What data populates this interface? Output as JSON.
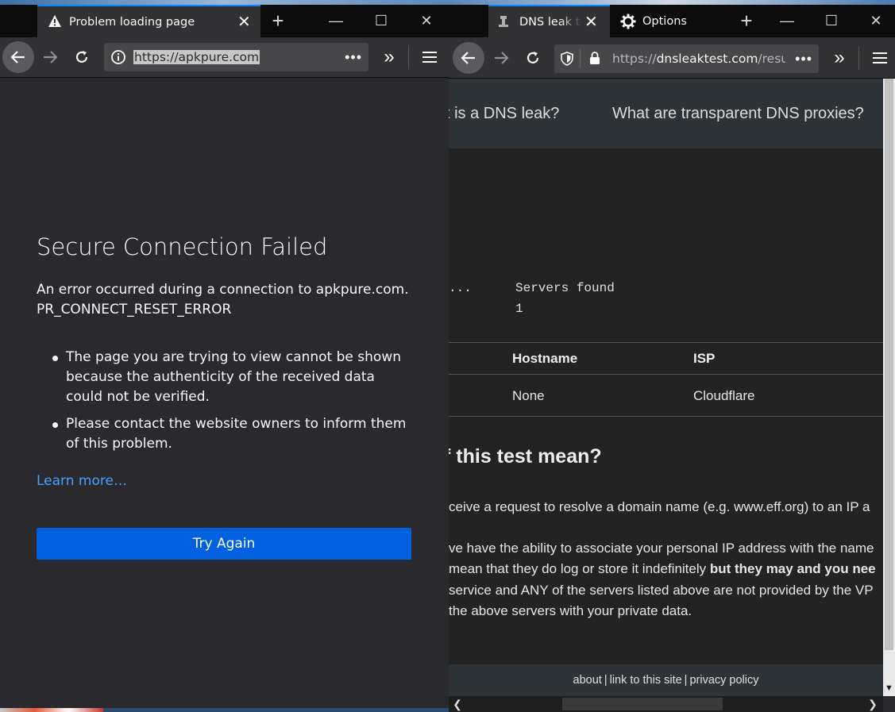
{
  "left_window": {
    "tab": {
      "title": "Problem loading page"
    },
    "url": "https://apkpure.com",
    "error": {
      "title": "Secure Connection Failed",
      "description": "An error occurred during a connection to apkpure.com.",
      "code": "PR_CONNECT_RESET_ERROR",
      "bullets": [
        "The page you are trying to view cannot be shown because the authenticity of the received data could not be verified.",
        "Please contact the website owners to inform them of this problem."
      ],
      "learn_more": "Learn more…",
      "try_again": "Try Again"
    }
  },
  "right_window": {
    "tabs": [
      {
        "title": "DNS leak test"
      },
      {
        "title": "Options"
      }
    ],
    "url_prefix": "https://",
    "url_host": "dnsleaktest.com",
    "url_path": "/results",
    "nav": {
      "item1": "t is a DNS leak?",
      "item2": "What are transparent DNS proxies?"
    },
    "summary": {
      "ellipsis": "...",
      "servers_label": "Servers found",
      "servers_count": "1"
    },
    "table": {
      "headers": [
        "Hostname",
        "ISP"
      ],
      "rows": [
        [
          "None",
          "Cloudflare"
        ]
      ]
    },
    "section_title": "f this test mean?",
    "paragraph_lines": [
      "ceive a request to resolve a domain name (e.g. www.eff.org) to an IP a",
      "ve have the ability to associate your personal IP address with the name",
      "mean that they do log or store it indefinitely ",
      "but they may and you nee",
      "service and ANY of the servers listed above are not provided by the VP",
      " the above servers with your private data."
    ],
    "footer": {
      "about": "about",
      "link": "link to this site",
      "privacy": "privacy policy",
      "sep": "|"
    }
  },
  "icons": {
    "warning": "warning-icon",
    "settings": "gear-icon"
  },
  "colors": {
    "accent_blue": "#0a84ff",
    "button_blue": "#0060df",
    "link_blue": "#45a1ff",
    "page_bg": "#2a2a2e"
  }
}
